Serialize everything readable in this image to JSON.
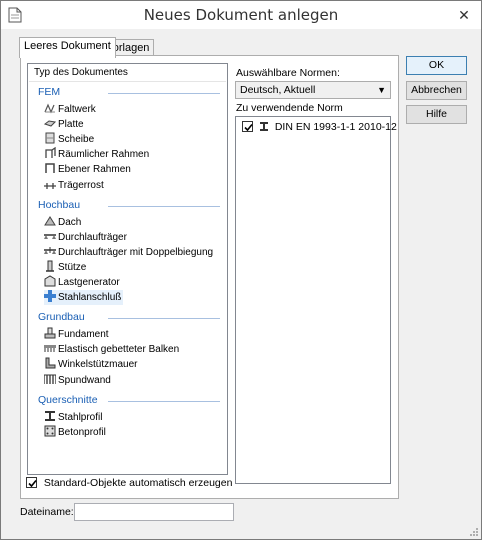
{
  "window": {
    "title": "Neues Dokument anlegen",
    "close_glyph": "✕"
  },
  "tabs": [
    {
      "label": "Leeres Dokument",
      "active": true
    },
    {
      "label": "Vorlagen",
      "active": false
    }
  ],
  "doc_list": {
    "header": "Typ des Dokumentes",
    "categories": [
      {
        "label": "FEM",
        "items": [
          {
            "label": "Faltwerk",
            "icon": "faltwerk-icon"
          },
          {
            "label": "Platte",
            "icon": "platte-icon"
          },
          {
            "label": "Scheibe",
            "icon": "scheibe-icon"
          },
          {
            "label": "Räumlicher Rahmen",
            "icon": "raeumlicher-rahmen-icon"
          },
          {
            "label": "Ebener Rahmen",
            "icon": "ebener-rahmen-icon"
          },
          {
            "label": "Trägerrost",
            "icon": "traegerrost-icon"
          }
        ]
      },
      {
        "label": "Hochbau",
        "items": [
          {
            "label": "Dach",
            "icon": "dach-icon"
          },
          {
            "label": "Durchlaufträger",
            "icon": "durchlauftraeger-icon"
          },
          {
            "label": "Durchlaufträger mit Doppelbiegung",
            "icon": "doppelbiegung-icon"
          },
          {
            "label": "Stütze",
            "icon": "stuetze-icon"
          },
          {
            "label": "Lastgenerator",
            "icon": "lastgenerator-icon"
          },
          {
            "label": "Stahlanschluß",
            "icon": "stahlanschluss-icon",
            "selected": true
          }
        ]
      },
      {
        "label": "Grundbau",
        "items": [
          {
            "label": "Fundament",
            "icon": "fundament-icon"
          },
          {
            "label": "Elastisch gebetteter Balken",
            "icon": "gebetteter-balken-icon"
          },
          {
            "label": "Winkelstützmauer",
            "icon": "winkelstuetzmauer-icon"
          },
          {
            "label": "Spundwand",
            "icon": "spundwand-icon"
          }
        ]
      },
      {
        "label": "Querschnitte",
        "items": [
          {
            "label": "Stahlprofil",
            "icon": "stahlprofil-icon"
          },
          {
            "label": "Betonprofil",
            "icon": "betonprofil-icon"
          }
        ]
      }
    ]
  },
  "norms": {
    "available_label": "Auswählbare Normen:",
    "selected_value": "Deutsch, Aktuell",
    "used_label": "Zu verwendende Norm",
    "items": [
      {
        "label": "DIN EN 1993-1-1 2010-12",
        "checked": true
      }
    ]
  },
  "buttons": {
    "ok": "OK",
    "cancel": "Abbrechen",
    "help": "Hilfe"
  },
  "auto_create": {
    "label": "Standard-Objekte automatisch erzeugen",
    "checked": true
  },
  "filename": {
    "label": "Dateiname:",
    "value": ""
  },
  "colors": {
    "category_text": "#1a5fb4",
    "selected_row": "#e5f0fb",
    "default_button_border": "#3c7fb1"
  }
}
